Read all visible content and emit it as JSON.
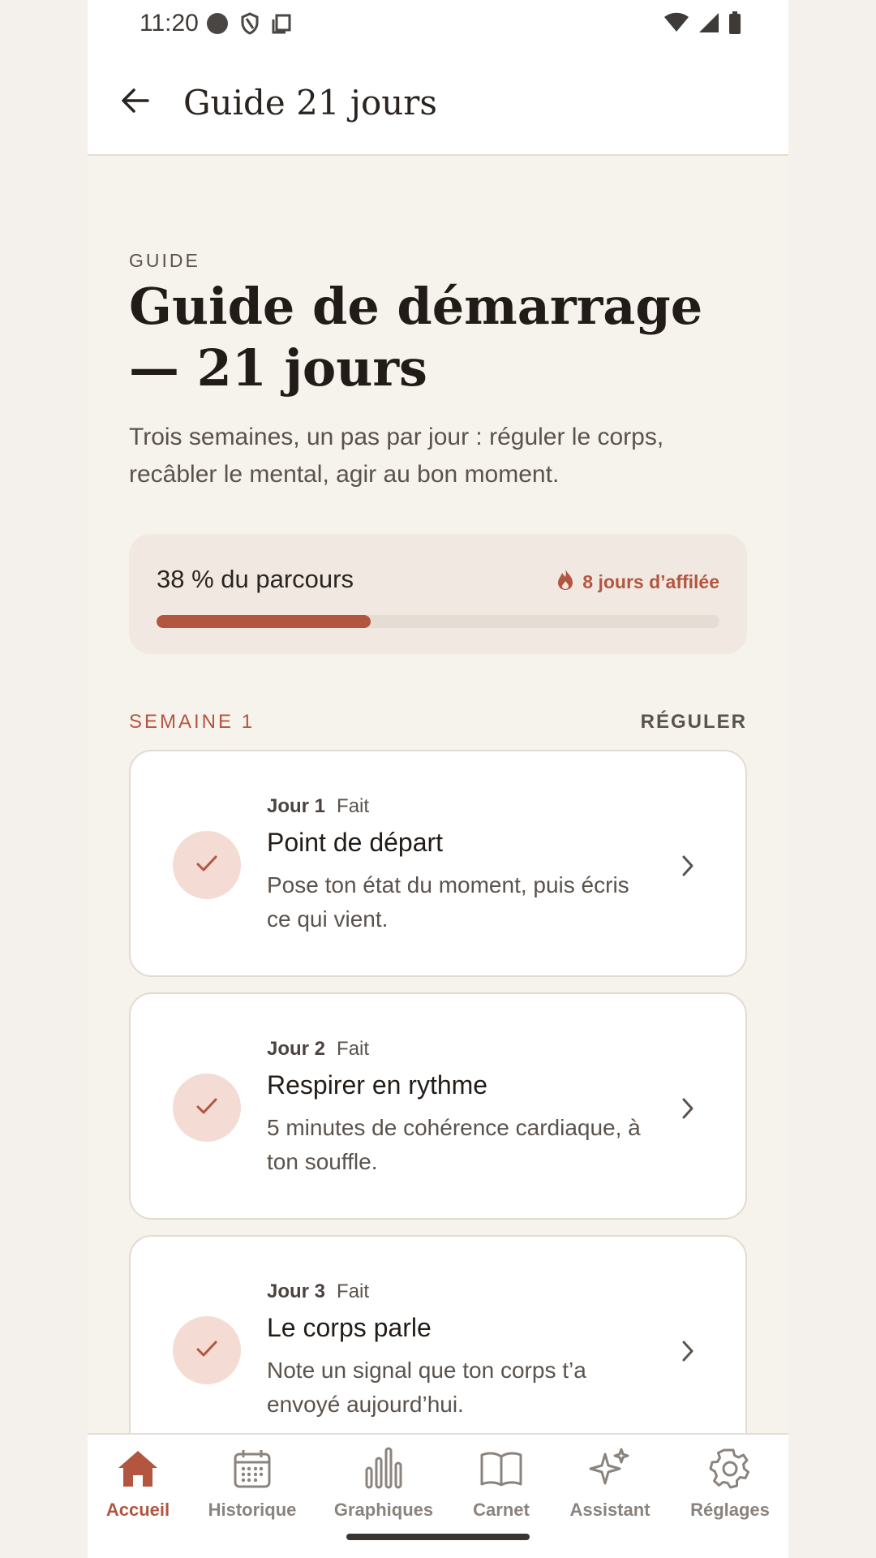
{
  "status_bar": {
    "time": "11:20"
  },
  "app_bar": {
    "title": "Guide 21 jours"
  },
  "guide": {
    "eyebrow": "GUIDE",
    "headline": "Guide de démarrage — 21 jours",
    "intro": "Trois semaines, un pas par jour : réguler le corps, recâbler le mental, agir au bon moment."
  },
  "progress": {
    "label": "38 % du parcours",
    "percent": 38,
    "streak": "8 jours d’affilée"
  },
  "week": {
    "label": "SEMAINE 1",
    "theme": "RÉGULER"
  },
  "days": [
    {
      "num": "Jour 1",
      "status": "Fait",
      "title": "Point de départ",
      "desc": "Pose ton état du moment, puis écris ce qui vient."
    },
    {
      "num": "Jour 2",
      "status": "Fait",
      "title": "Respirer en rythme",
      "desc": "5 minutes de cohérence cardiaque, à ton souffle."
    },
    {
      "num": "Jour 3",
      "status": "Fait",
      "title": "Le corps parle",
      "desc": "Note un signal que ton corps t’a envoyé aujourd’hui."
    }
  ],
  "nav": [
    {
      "label": "Accueil",
      "icon": "home-icon",
      "active": true
    },
    {
      "label": "Historique",
      "icon": "calendar-icon",
      "active": false
    },
    {
      "label": "Graphiques",
      "icon": "bar-chart-icon",
      "active": false
    },
    {
      "label": "Carnet",
      "icon": "book-icon",
      "active": false
    },
    {
      "label": "Assistant",
      "icon": "sparkles-icon",
      "active": false
    },
    {
      "label": "Réglages",
      "icon": "gear-icon",
      "active": false
    }
  ],
  "colors": {
    "accent": "#b25640",
    "background": "#f6f2ec",
    "card": "#ffffff"
  }
}
